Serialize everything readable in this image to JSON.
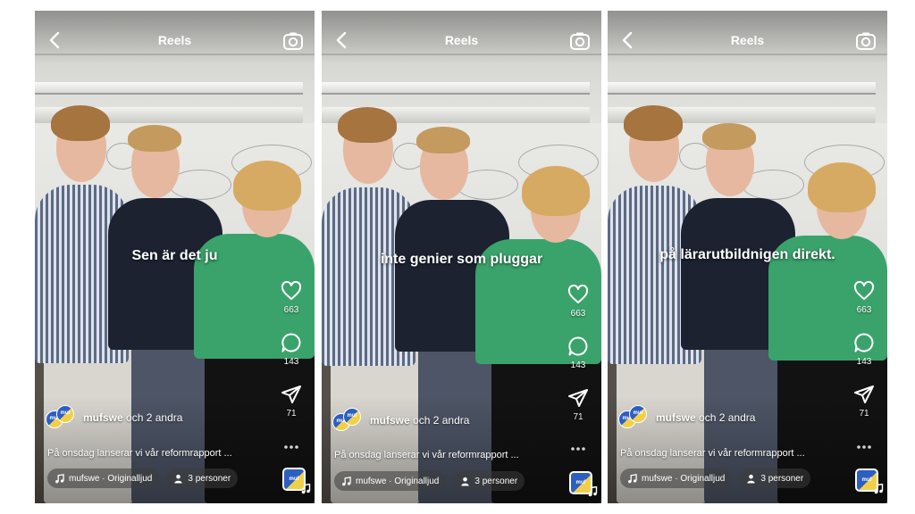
{
  "screens": [
    {
      "title": "Reels",
      "caption": "Sen är det ju",
      "likes": "663",
      "comments": "143",
      "shares": "71",
      "author": "mufswe",
      "author_suffix": "och 2 andra",
      "description": "På onsdag lanserar vi vår reformrapport ...",
      "audio": "mufswe · Originalljud",
      "people": "3 personer",
      "avatar_text": "muf"
    },
    {
      "title": "Reels",
      "caption": "inte genier som pluggar",
      "likes": "663",
      "comments": "143",
      "shares": "71",
      "author": "mufswe",
      "author_suffix": "och 2 andra",
      "description": "På onsdag lanserar vi vår reformrapport ...",
      "audio": "mufswe · Originalljud",
      "people": "3 personer",
      "avatar_text": "muf"
    },
    {
      "title": "Reels",
      "caption": "på lärarutbildnigen direkt.",
      "likes": "663",
      "comments": "143",
      "shares": "71",
      "author": "mufswe",
      "author_suffix": "och 2 andra",
      "description": "På onsdag lanserar vi vår reformrapport ...",
      "audio": "mufswe · Originalljud",
      "people": "3 personer",
      "avatar_text": "muf"
    }
  ],
  "colors": {
    "shirt_green": "#3aa36b",
    "sweater_navy": "#1d2230",
    "stripe_shirt": "#5b6a86",
    "brand_blue": "#2d5ec2",
    "brand_yellow": "#f0d04a"
  },
  "icons": [
    "back-icon",
    "camera-icon",
    "heart-icon",
    "comment-icon",
    "share-icon",
    "more-icon",
    "music-note-icon",
    "person-icon"
  ]
}
